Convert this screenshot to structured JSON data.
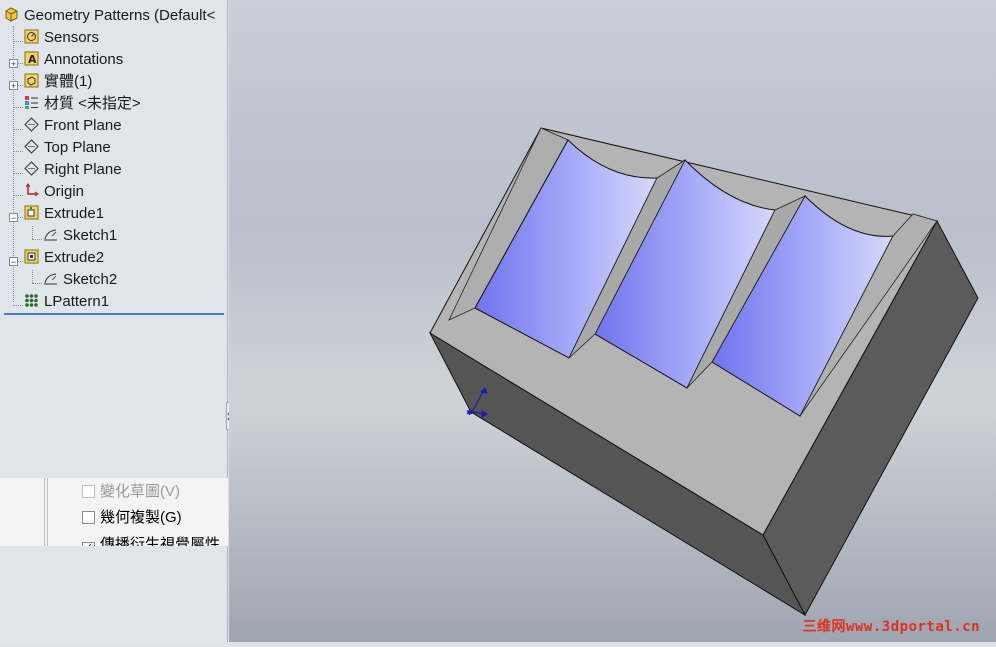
{
  "tree": {
    "root": "Geometry Patterns  (Default<",
    "items": [
      {
        "label": "Sensors",
        "icon": "sensors-icon"
      },
      {
        "label": "Annotations",
        "icon": "annotations-icon"
      },
      {
        "label": "實體(1)",
        "icon": "solid-bodies-icon"
      },
      {
        "label": "材質 <未指定>",
        "icon": "material-icon"
      },
      {
        "label": "Front Plane",
        "icon": "plane-icon"
      },
      {
        "label": "Top Plane",
        "icon": "plane-icon"
      },
      {
        "label": "Right Plane",
        "icon": "plane-icon"
      },
      {
        "label": "Origin",
        "icon": "origin-icon"
      },
      {
        "label": "Extrude1",
        "icon": "extrude-icon"
      },
      {
        "label": "Sketch1",
        "icon": "sketch-icon"
      },
      {
        "label": "Extrude2",
        "icon": "extrude-icon"
      },
      {
        "label": "Sketch2",
        "icon": "sketch-icon"
      },
      {
        "label": "LPattern1",
        "icon": "linear-pattern-icon"
      }
    ]
  },
  "options": [
    {
      "label": "變化草圖(V)",
      "checked": false,
      "enabled": false
    },
    {
      "label": "幾何複製(G)",
      "checked": false,
      "enabled": true
    },
    {
      "label": "傳播衍生視覺屬性",
      "checked": true,
      "enabled": true
    }
  ],
  "watermark": "三维网www.3dportal.cn",
  "colors": {
    "model_face": "#b4b4b4",
    "model_side": "#5b5b5b",
    "channel": "#8a8ef5",
    "selection_line": "#4a7cb8"
  }
}
